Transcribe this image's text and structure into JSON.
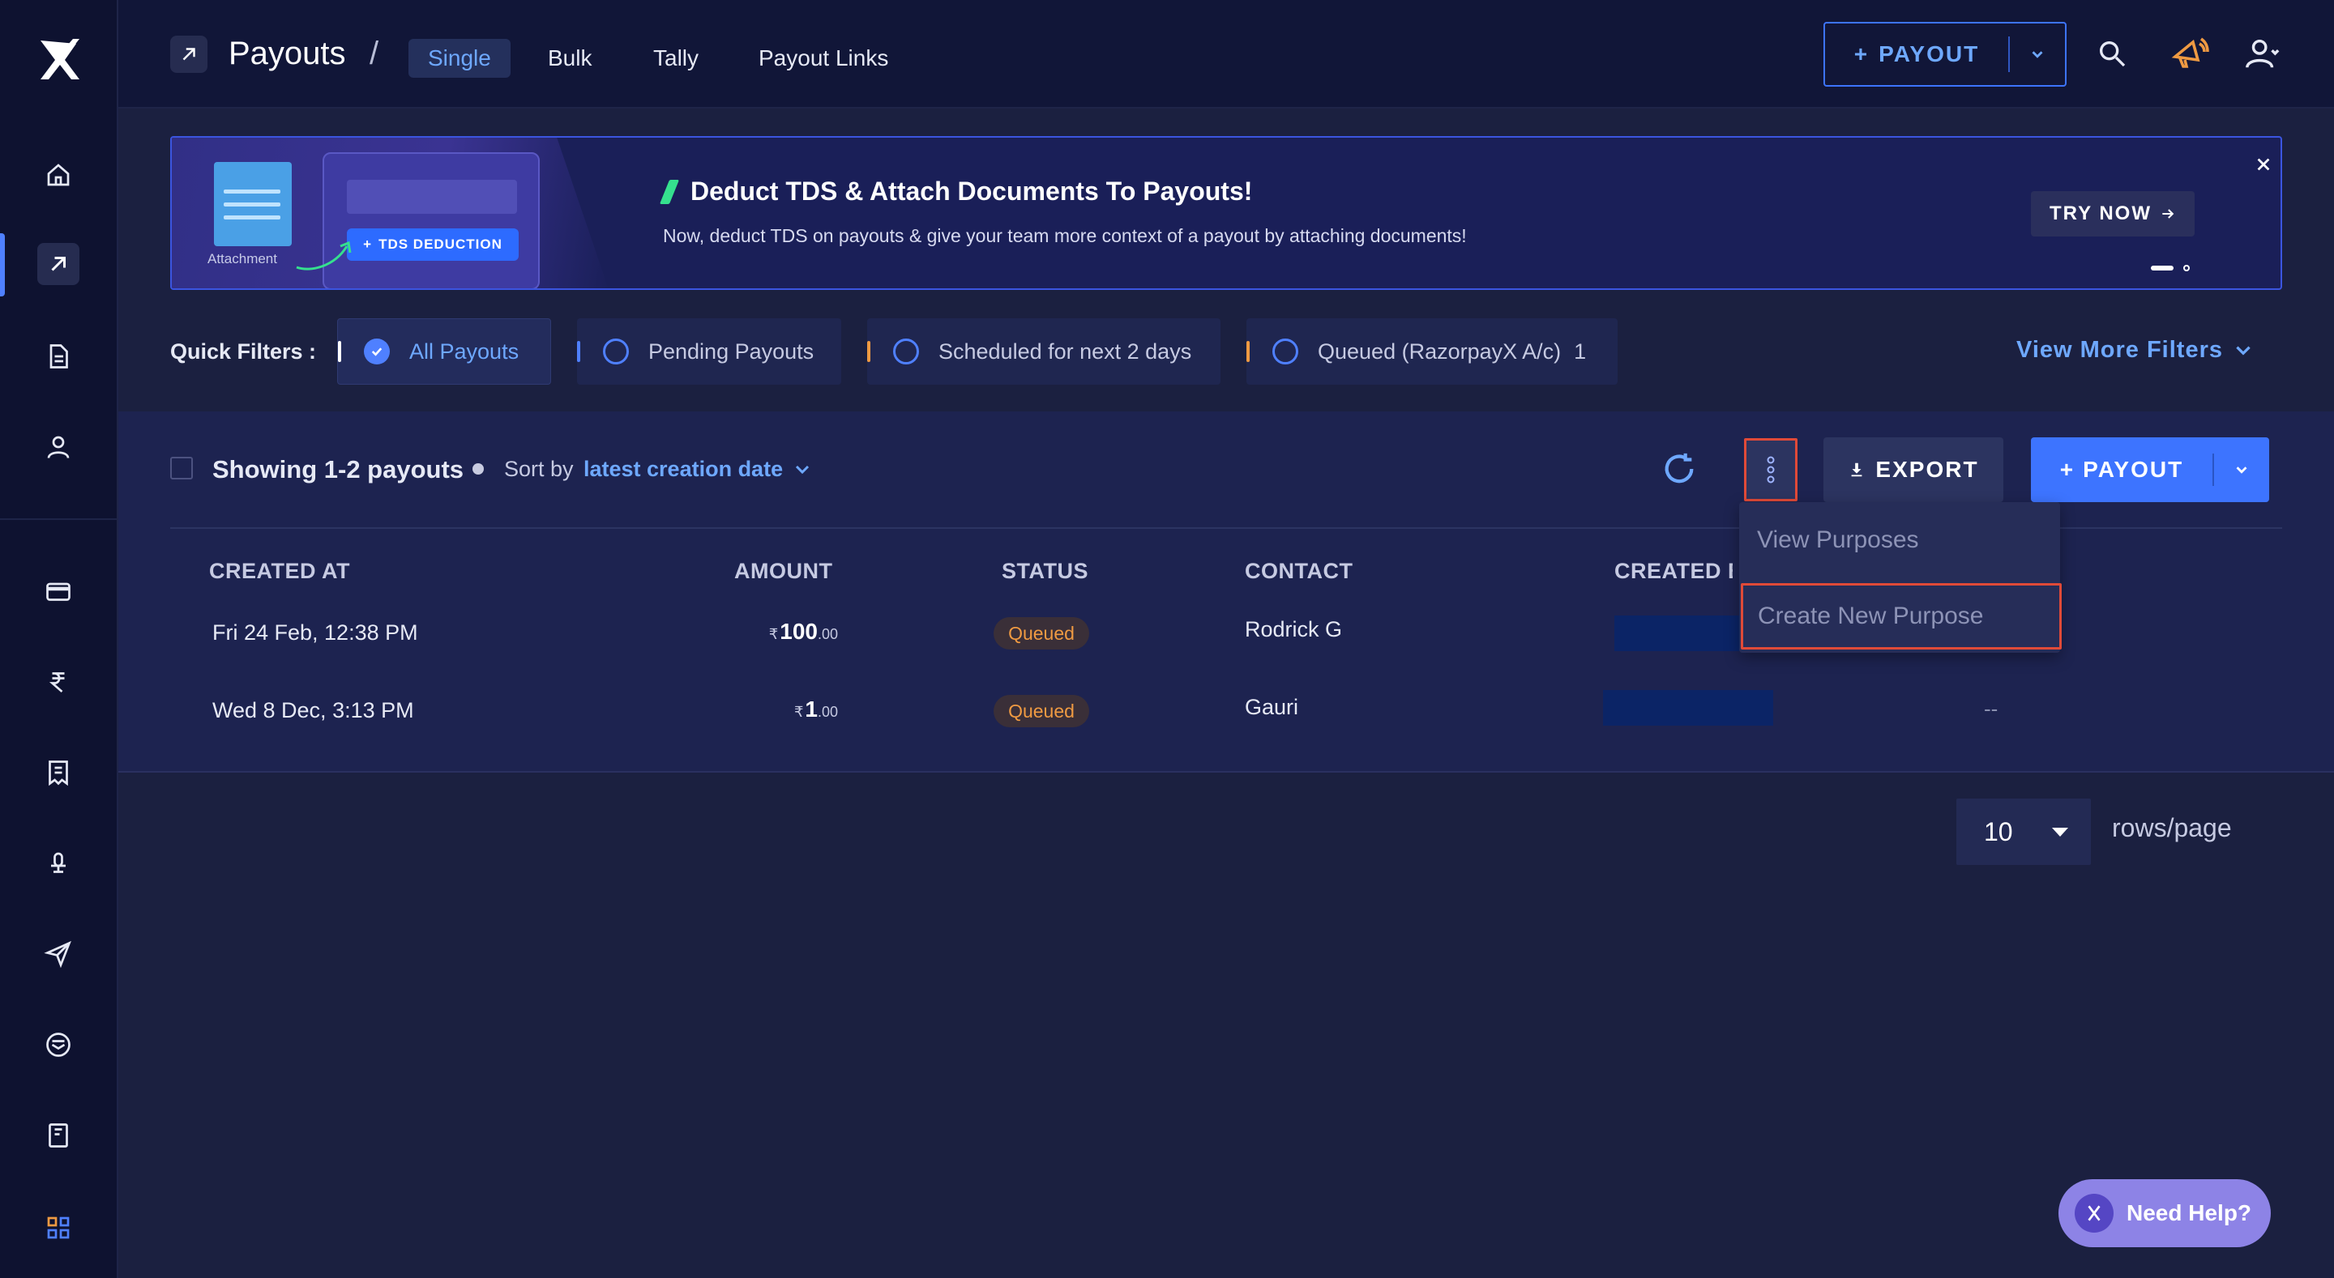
{
  "header": {
    "title": "Payouts",
    "separator": "/",
    "tabs": [
      {
        "label": "Single",
        "active": true
      },
      {
        "label": "Bulk",
        "active": false
      },
      {
        "label": "Tally",
        "active": false
      },
      {
        "label": "Payout Links",
        "active": false
      }
    ],
    "payout_button": "PAYOUT"
  },
  "sidebar": {
    "items": [
      {
        "icon": "home-icon"
      },
      {
        "icon": "payouts-arrow-icon",
        "active": true
      },
      {
        "icon": "document-icon"
      },
      {
        "icon": "contacts-icon"
      },
      {
        "icon": "card-icon"
      },
      {
        "icon": "rupee-icon"
      },
      {
        "icon": "invoice-icon"
      },
      {
        "icon": "tax-icon"
      },
      {
        "icon": "send-icon"
      },
      {
        "icon": "inbox-icon"
      },
      {
        "icon": "book-icon"
      },
      {
        "icon": "apps-grid-icon"
      }
    ]
  },
  "banner": {
    "attachment_label": "Attachment",
    "tds_label": "TDS DEDUCTION",
    "title": "Deduct TDS & Attach Documents To Payouts!",
    "description": "Now, deduct TDS on payouts & give your team more context of a payout by attaching documents!",
    "cta": "TRY NOW"
  },
  "quick_filters": {
    "label": "Quick Filters :",
    "chips": [
      {
        "label": "All Payouts",
        "active": true,
        "bar_color": "#ffffff"
      },
      {
        "label": "Pending Payouts",
        "active": false,
        "bar_color": "#4f80ff"
      },
      {
        "label": "Scheduled for next 2 days",
        "active": false,
        "bar_color": "#ef9a42"
      },
      {
        "label": "Queued (RazorpayX A/c)",
        "count": "1",
        "active": false,
        "bar_color": "#ef9a42"
      }
    ],
    "more": "View More Filters"
  },
  "table_toolbar": {
    "showing": "Showing 1-2 payouts",
    "sort_label": "Sort by",
    "sort_value": "latest creation date",
    "export": "EXPORT",
    "payout": "PAYOUT"
  },
  "table": {
    "columns": [
      "CREATED AT",
      "AMOUNT",
      "STATUS",
      "CONTACT",
      "CREATED BY"
    ],
    "rows": [
      {
        "created_at": "Fri 24 Feb, 12:38 PM",
        "currency": "₹",
        "amount": "100",
        "decimals": ".00",
        "status": "Queued",
        "contact": "Rodrick G",
        "extra": ""
      },
      {
        "created_at": "Wed 8 Dec, 3:13 PM",
        "currency": "₹",
        "amount": "1",
        "decimals": ".00",
        "status": "Queued",
        "contact": "Gauri",
        "extra": "--"
      }
    ]
  },
  "menu": {
    "items": [
      "View Purposes",
      "Create New Purpose"
    ]
  },
  "pagination": {
    "rows_value": "10",
    "rows_label": "rows/page"
  },
  "help": {
    "label": "Need Help?"
  },
  "colors": {
    "accent": "#3d74ff",
    "highlight": "#e04a38",
    "queued": "#ef9a42"
  }
}
